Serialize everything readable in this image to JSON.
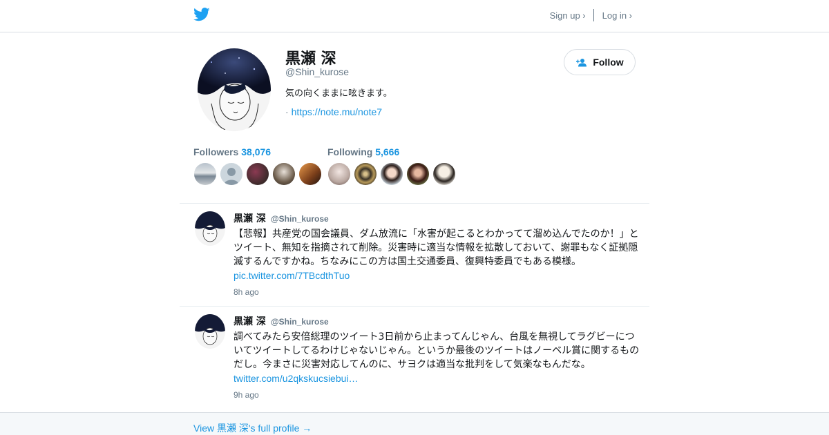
{
  "header": {
    "logo": "twitter-bird-icon",
    "signup_label": "Sign up ›",
    "login_label": "Log in ›"
  },
  "profile": {
    "name": "黒瀬 深",
    "handle": "@Shin_kurose",
    "bio": "気の向くままに呟きます。",
    "url_prefix": "·",
    "url": "https://note.mu/note7",
    "follow_label": "Follow"
  },
  "stats": {
    "followers_label": "Followers",
    "followers_count": "38,076",
    "following_label": "Following",
    "following_count": "5,666"
  },
  "tweets": [
    {
      "name": "黒瀬 深",
      "handle": "@Shin_kurose",
      "text": "【悲報】共産党の国会議員、ダム放流に「水害が起こるとわかってて溜め込んでたのか！」とツイート、無知を指摘されて削除。災害時に適当な情報を拡散しておいて、謝罪もなく証拠隠滅するんですかね。ちなみにこの方は国土交通委員、復興特委員でもある模様。",
      "link": "pic.twitter.com/7TBcdthTuo",
      "time": "8h ago"
    },
    {
      "name": "黒瀬 深",
      "handle": "@Shin_kurose",
      "text": "調べてみたら安倍総理のツイート3日前から止まってんじゃん、台風を無視してラグビーについてツイートしてるわけじゃないじゃん。というか最後のツイートはノーベル賞に関するものだし。今まさに災害対応してんのに、サヨクは適当な批判をして気楽なもんだな。",
      "link": "twitter.com/u2qkskucsiebui…",
      "time": "9h ago"
    }
  ],
  "footer": {
    "link_label": "View 黒瀬 深's full profile →"
  },
  "colors": {
    "link": "#1b95e0",
    "muted": "#657786",
    "text": "#14171a",
    "border": "#d8dde2"
  }
}
